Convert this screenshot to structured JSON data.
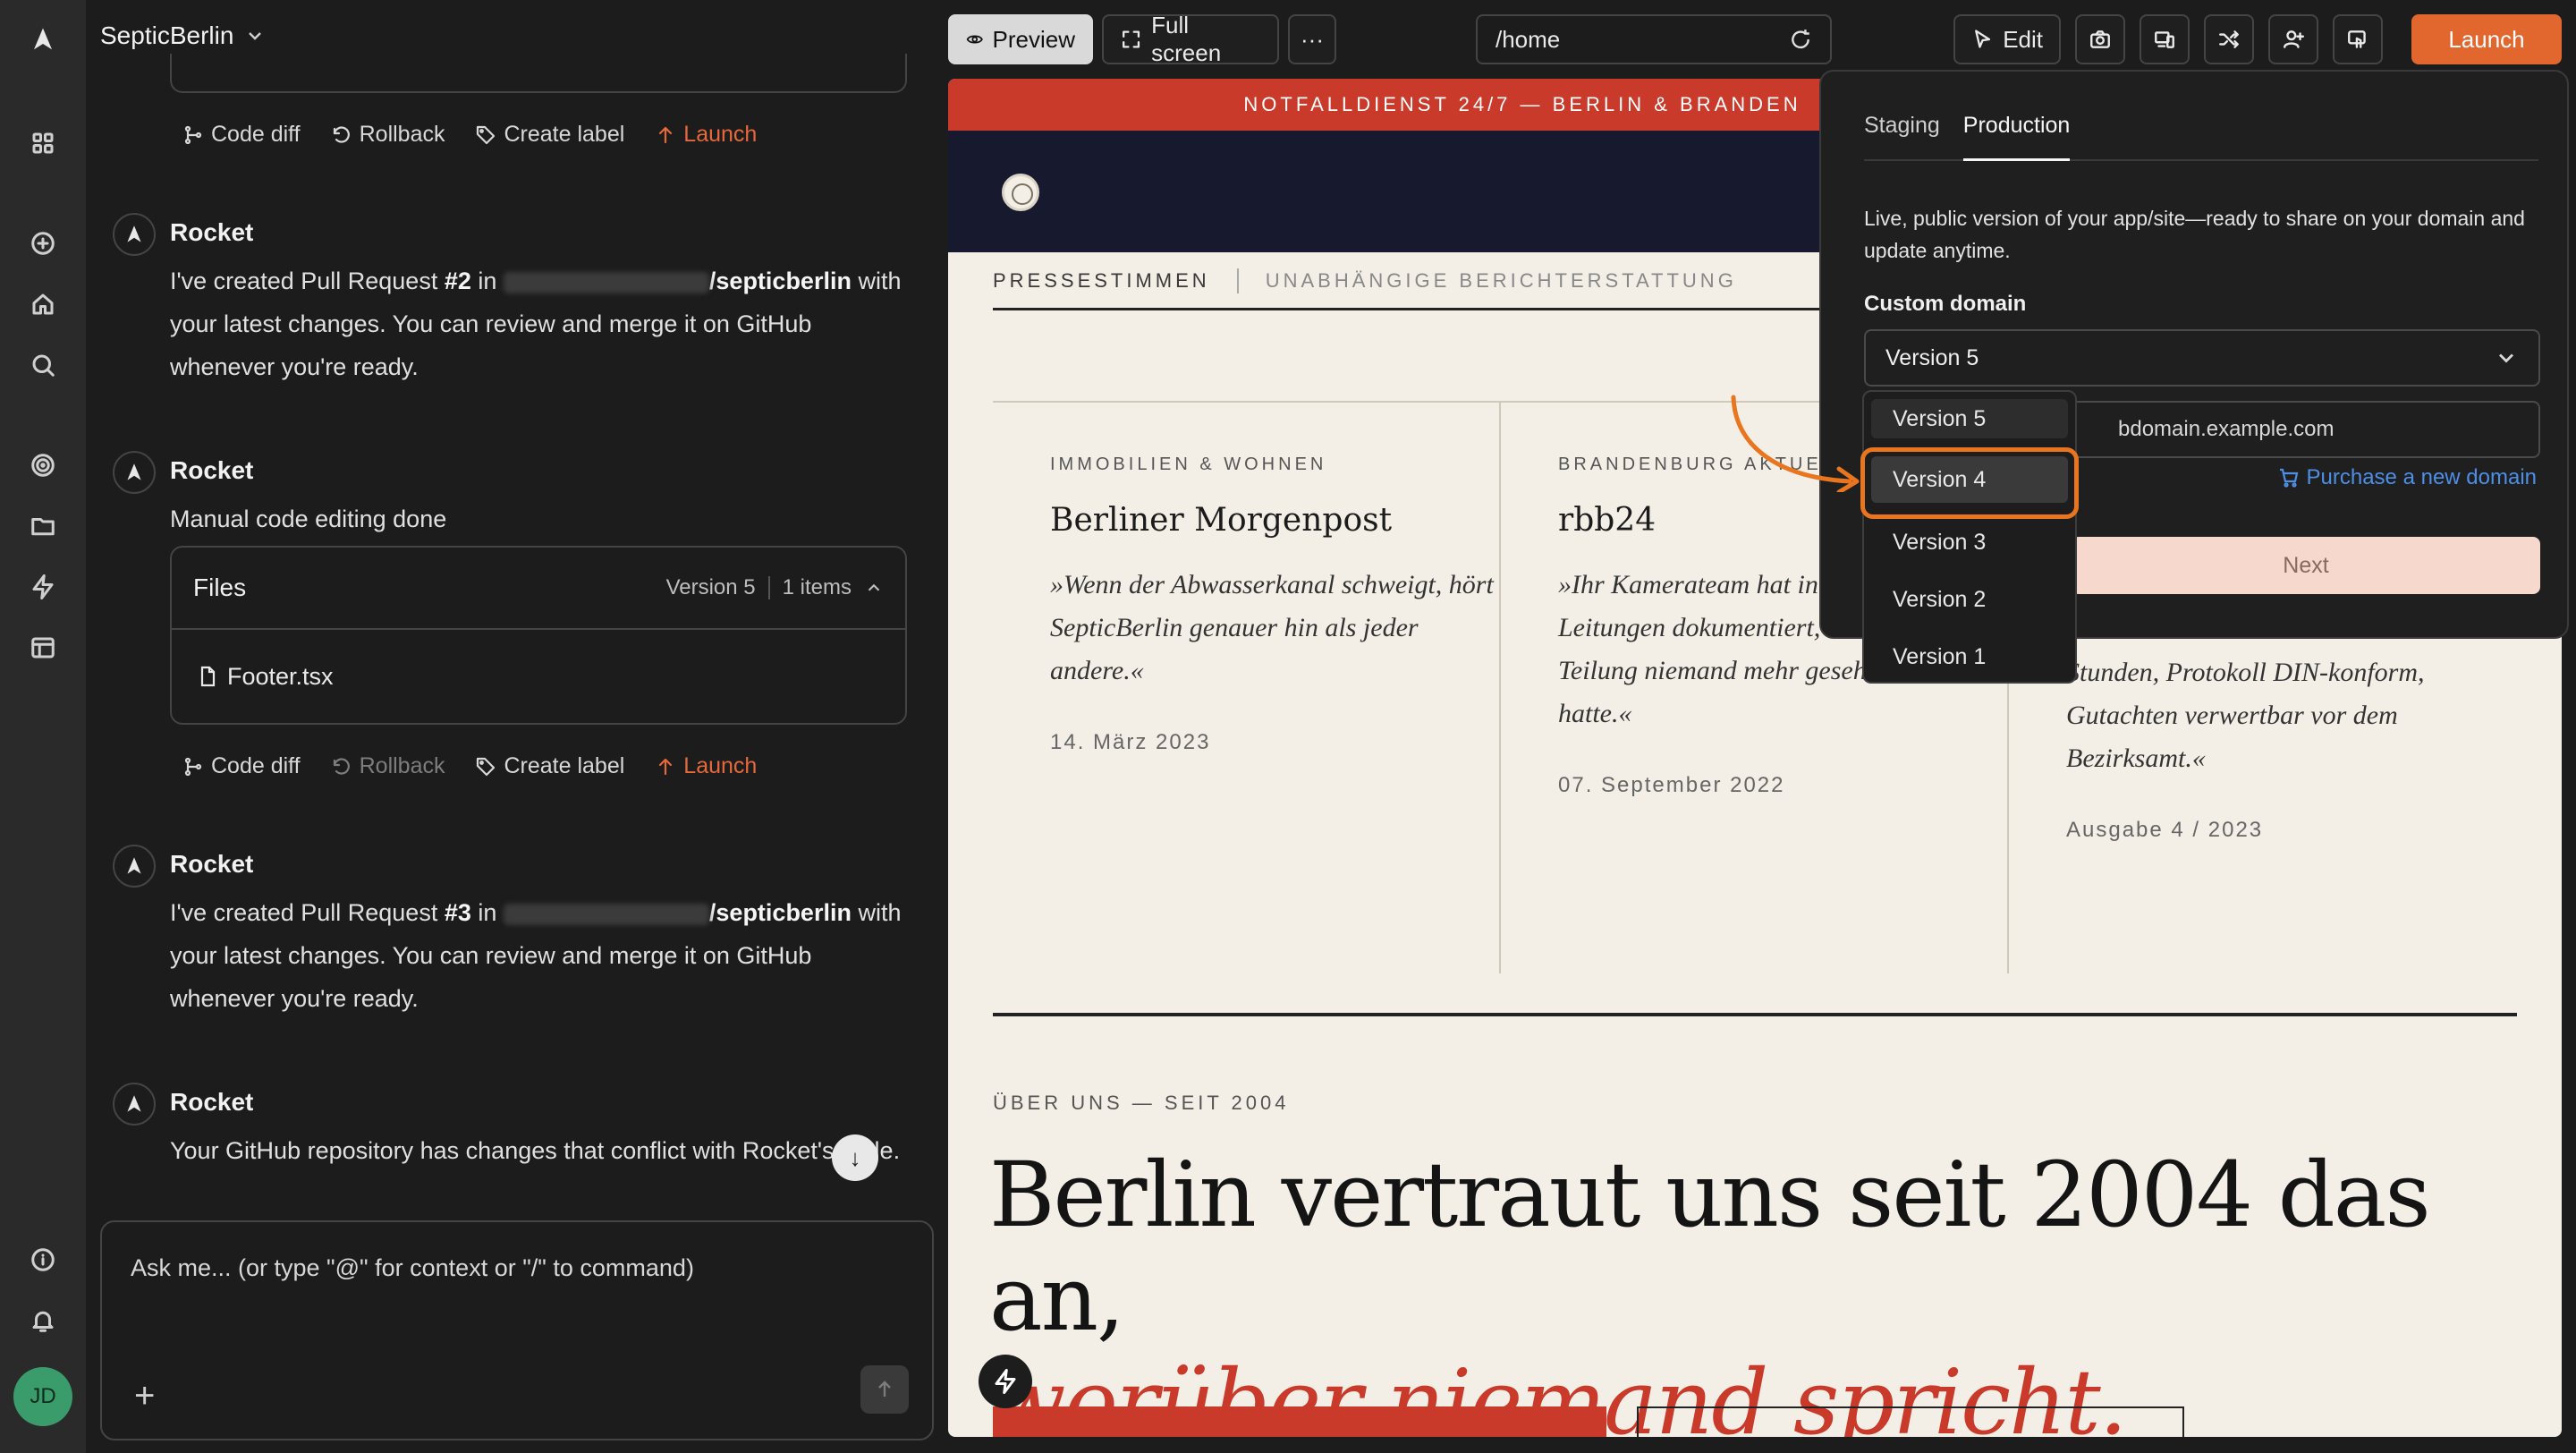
{
  "app": {
    "project_name": "SepticBerlin",
    "user_initials": "JD",
    "brand_color": "#e2672f"
  },
  "rail": {
    "icons": [
      "logo-icon",
      "grid-icon",
      "plus-circle-icon",
      "home-icon",
      "search-icon",
      "target-icon",
      "folder-icon",
      "bolt-icon",
      "layout-icon",
      "info-icon",
      "bell-icon"
    ]
  },
  "chat": {
    "action_rows": [
      {
        "code_diff": "Code diff",
        "rollback": "Rollback",
        "create_label": "Create label",
        "launch": "Launch"
      },
      {
        "code_diff": "Code diff",
        "rollback": "Rollback",
        "create_label": "Create label",
        "launch": "Launch"
      }
    ],
    "messages": [
      {
        "author": "Rocket",
        "pre": "I've created Pull Request ",
        "pr": "#2",
        "mid": " in ",
        "repo": "/septicberlin",
        "post": " with your latest changes. You can review and merge it on GitHub whenever you're ready."
      },
      {
        "author": "Rocket",
        "text": "Manual code editing done"
      },
      {
        "author": "Rocket",
        "pre": "I've created Pull Request ",
        "pr": "#3",
        "mid": " in ",
        "repo": "/septicberlin",
        "post": " with your latest changes. You can review and merge it on GitHub whenever you're ready."
      },
      {
        "author": "Rocket",
        "text": "Your GitHub repository has changes that conflict with Rocket's code."
      }
    ],
    "files_card": {
      "title": "Files",
      "version": "Version 5",
      "count": "1 items",
      "files": [
        "Footer.tsx"
      ]
    },
    "composer_placeholder": "Ask me... (or type \"@\" for context or \"/\" to command)"
  },
  "toolbar": {
    "preview": "Preview",
    "full_screen": "Full screen",
    "more": "···",
    "url": "/home",
    "edit": "Edit",
    "launch": "Launch"
  },
  "preview": {
    "banner": "NOTFALLDIENST 24/7 — BERLIN & BRANDEN",
    "press_title": "PRESSESTIMMEN",
    "press_sub": "UNABHÄNGIGE BERICHTERSTATTUNG",
    "quotes": [
      {
        "category": "IMMOBILIEN & WOHNEN",
        "publication": "Berliner Morgenpost",
        "quote": "»Wenn der Abwasserkanal schweigt, hört SepticBerlin genauer hin als jeder andere.«",
        "date": "14. März 2023"
      },
      {
        "category": "BRANDENBURG AKTUELL",
        "publication": "rbb24",
        "quote": "»Ihr Kamerateam hat in Spandau Leitungen dokumentiert, die seit der Teilung niemand mehr gesehen hatte.«",
        "date": "07. September 2022"
      },
      {
        "category": "",
        "publication": "",
        "quote": "Stunden, Protokoll DIN-konform, Gutachten verwertbar vor dem Bezirksamt.«",
        "date": "Ausgabe 4 / 2023"
      }
    ],
    "about_kicker": "ÜBER UNS — SEIT 2004",
    "headline_main": "Berlin vertraut uns seit 2004 das an,",
    "headline_accent": "worüber niemand spricht."
  },
  "deploy": {
    "tabs": [
      "Staging",
      "Production"
    ],
    "active_tab": "Production",
    "description": "Live, public version of your app/site—ready to share on your domain and update anytime.",
    "custom_domain_label": "Custom domain",
    "selected_version": "Version 5",
    "domain_placeholder": "bdomain.example.com",
    "purchase_link": "Purchase a new domain",
    "next": "Next",
    "versions": [
      "Version 5",
      "Version 4",
      "Version 3",
      "Version 2",
      "Version 1"
    ],
    "highlighted_version": "Version 4",
    "highlight_color": "#e9761e"
  }
}
